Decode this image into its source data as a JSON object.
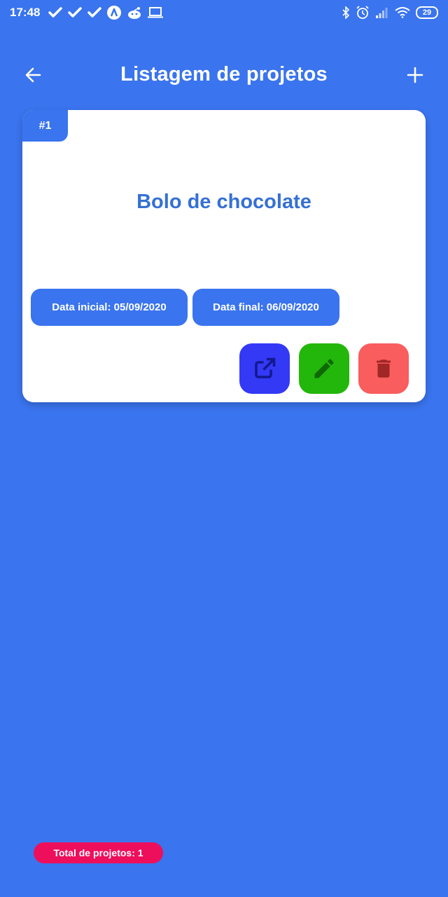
{
  "status_bar": {
    "time": "17:48",
    "battery": "29",
    "left_icons": [
      "check-icon",
      "check-icon",
      "check-icon",
      "app-a-icon",
      "reddit-icon",
      "laptop-icon"
    ],
    "right_icons": [
      "bluetooth-icon",
      "alarm-icon",
      "signal-icon",
      "wifi-icon",
      "battery-icon"
    ]
  },
  "header": {
    "title": "Listagem de projetos",
    "back_icon": "arrow-left-icon",
    "add_icon": "plus-icon"
  },
  "projects": [
    {
      "number": "#1",
      "name": "Bolo de chocolate",
      "start_date_label": "Data inicial: 05/09/2020",
      "end_date_label": "Data final: 06/09/2020",
      "actions": [
        {
          "name": "open",
          "icon": "open-external-icon",
          "color": "#3339f5"
        },
        {
          "name": "edit",
          "icon": "pencil-icon",
          "color": "#23b60b"
        },
        {
          "name": "delete",
          "icon": "trash-icon",
          "color": "#fa5d5d"
        }
      ]
    }
  ],
  "footer": {
    "total_label": "Total de projetos: 1"
  },
  "colors": {
    "background": "#3a74ee",
    "card": "#ffffff",
    "title_text": "#3570d4",
    "total_badge": "#ee0f5c"
  }
}
